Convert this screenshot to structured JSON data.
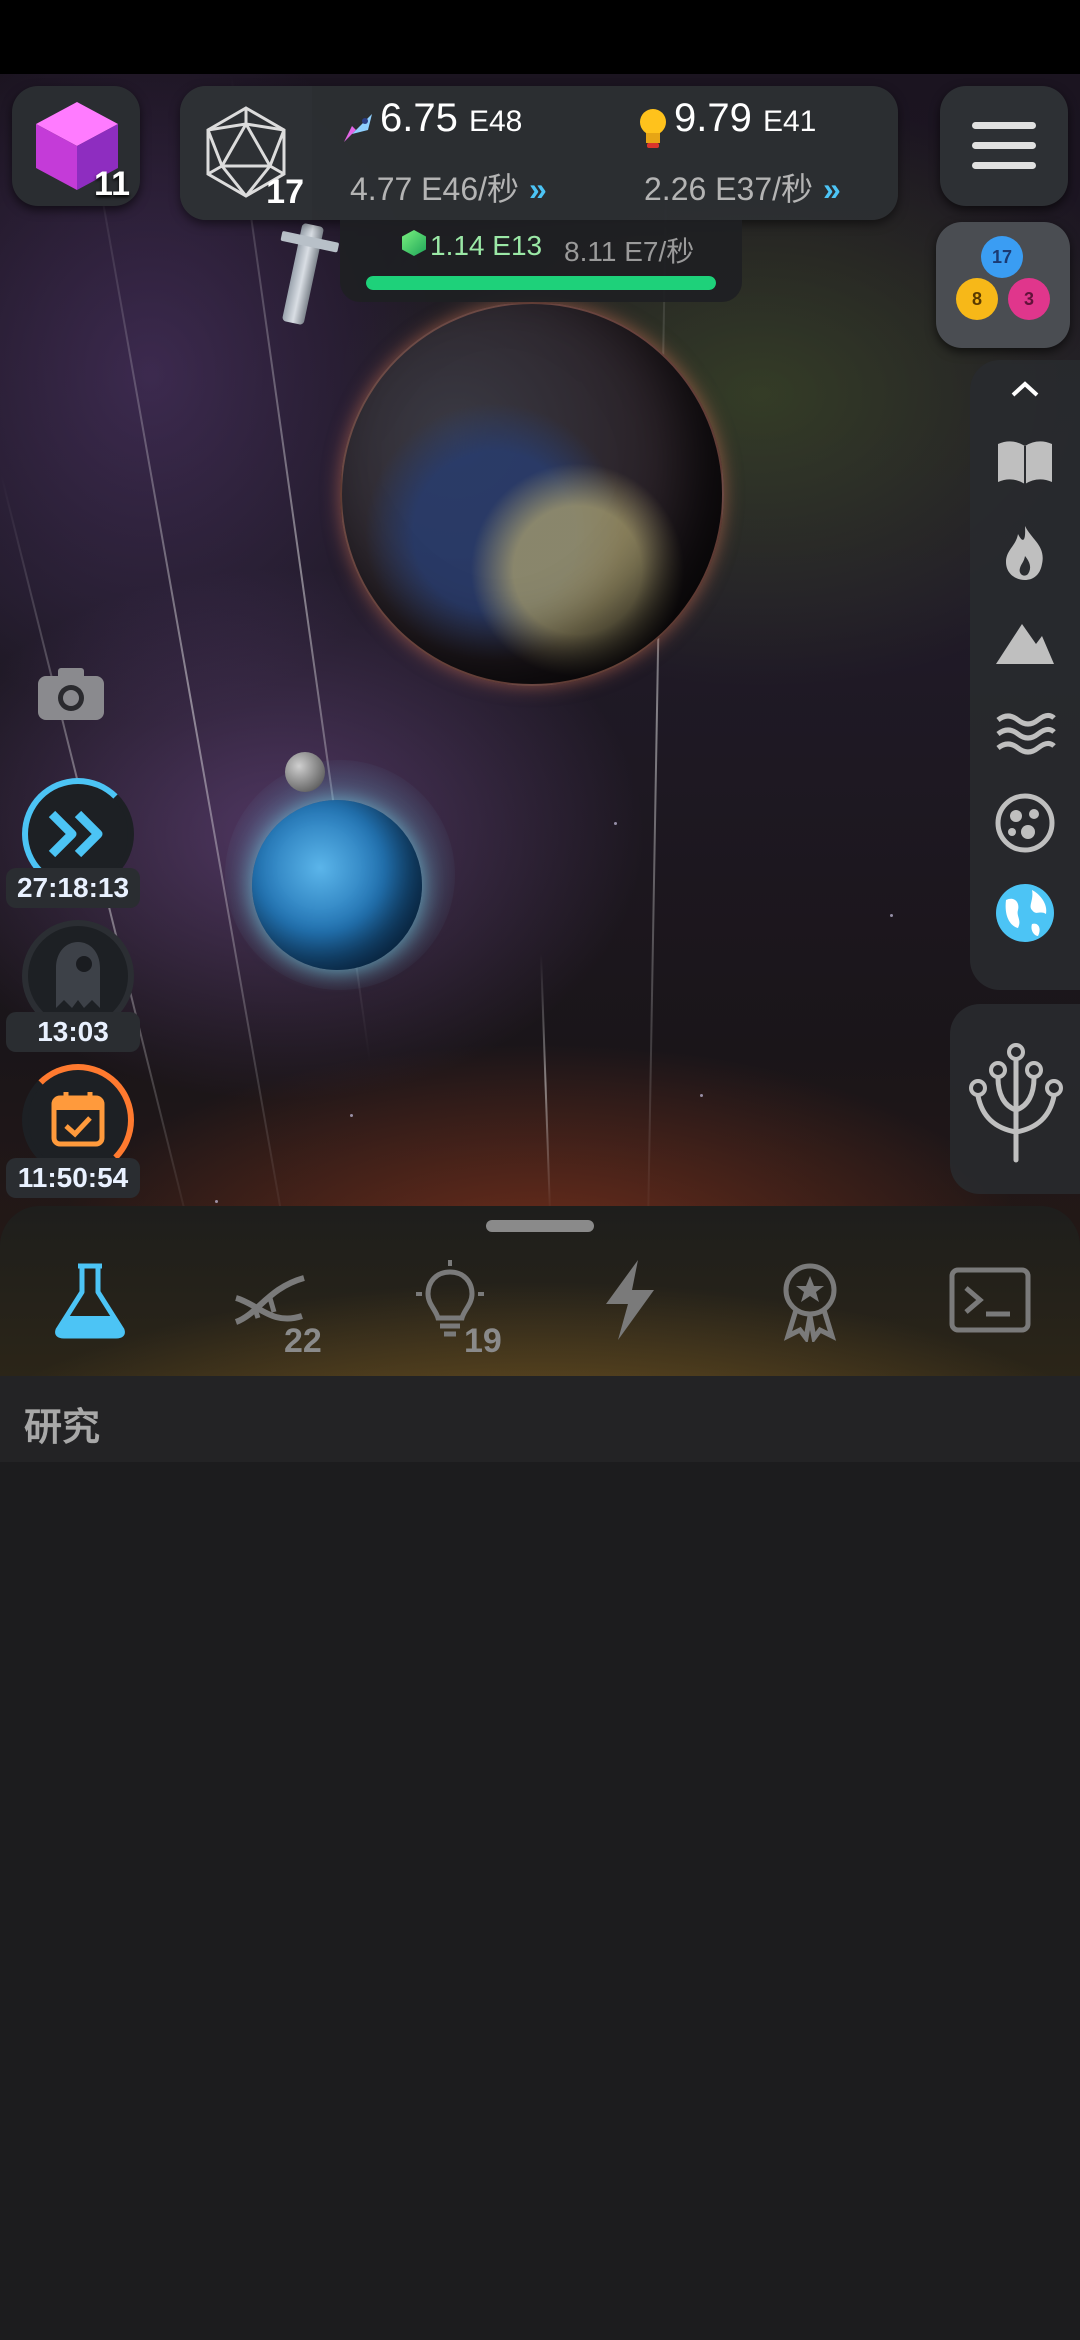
{
  "hud": {
    "cube_count": "11",
    "dice_level": "17",
    "energy": {
      "mantissa": "6.75",
      "exp": "E48"
    },
    "energy_rate": {
      "mantissa": "4.77",
      "exp": "E46/秒"
    },
    "idea": {
      "mantissa": "9.79",
      "exp": "E41"
    },
    "idea_rate": {
      "mantissa": "2.26",
      "exp": "E37/秒"
    },
    "gem": {
      "mantissa": "1.14",
      "exp": "E13"
    },
    "gem_rate": "8.11 E7/秒",
    "progress": 1.0
  },
  "triad": {
    "blue": "17",
    "yellow": "8",
    "pink": "3"
  },
  "timers": [
    {
      "label": "27:18:13"
    },
    {
      "label": "13:03"
    },
    {
      "label": "11:50:54"
    }
  ],
  "tabs": [
    {
      "name": "research",
      "badge": ""
    },
    {
      "name": "dna",
      "badge": "22"
    },
    {
      "name": "ideas",
      "badge": "19"
    },
    {
      "name": "energy",
      "badge": ""
    },
    {
      "name": "achievements",
      "badge": ""
    },
    {
      "name": "console",
      "badge": ""
    }
  ],
  "section": {
    "title": "研究"
  },
  "colors": {
    "accent": "#4cc4f5",
    "gem": "#9be8a6",
    "progress": "#1ed17a"
  }
}
